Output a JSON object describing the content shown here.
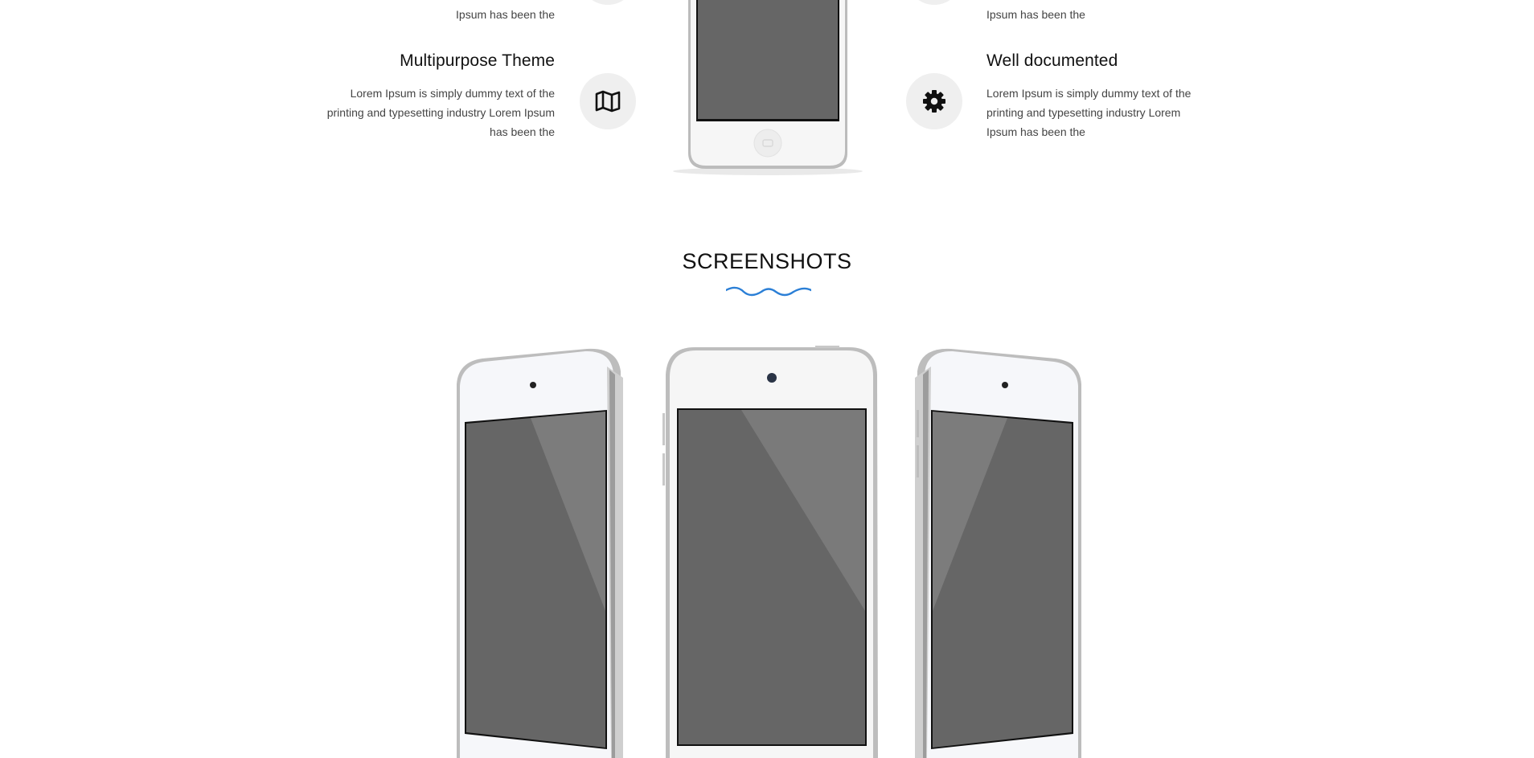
{
  "features": {
    "left_partial_desc": "Ipsum has been the",
    "right_partial_desc": "Ipsum has been the",
    "left": {
      "title": "Multipurpose Theme",
      "desc": "Lorem Ipsum is simply dummy text of the printing and typesetting industry Lorem Ipsum has been the",
      "icon": "map-icon"
    },
    "right": {
      "title": "Well documented",
      "desc": "Lorem Ipsum is simply dummy text of the printing and typesetting industry Lorem Ipsum has been the",
      "icon": "gear-icon"
    }
  },
  "screenshots": {
    "title": "SCREENSHOTS",
    "accent_color": "#2b7fd6"
  }
}
